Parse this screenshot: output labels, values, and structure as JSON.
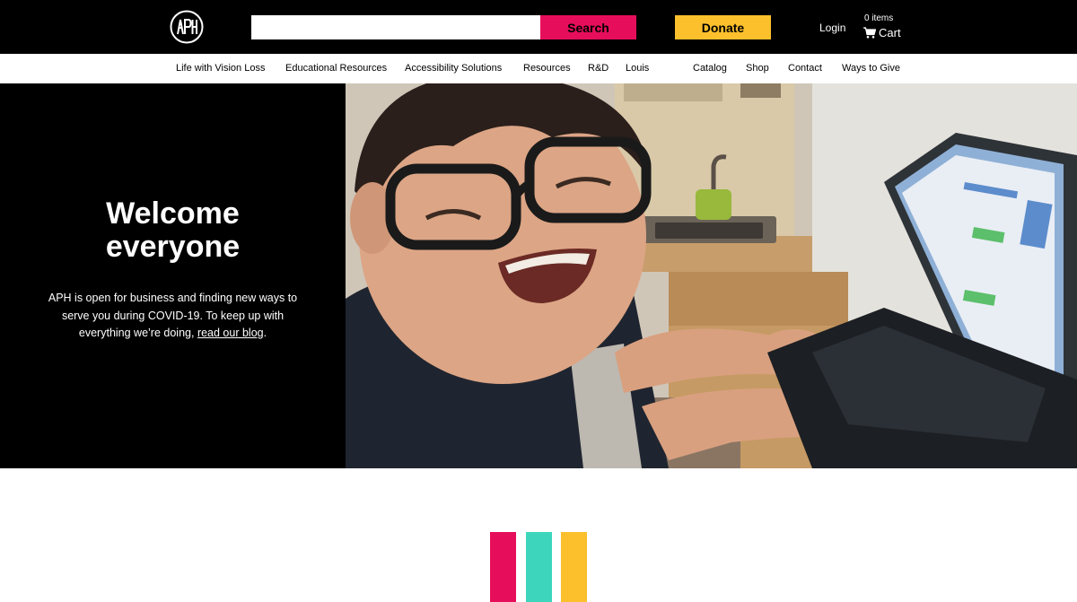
{
  "brand": {
    "logo_text": "APH",
    "colors": {
      "pink": "#e60e5a",
      "teal": "#3dd6bd",
      "yellow": "#fcc02d",
      "black": "#000000"
    }
  },
  "header": {
    "search": {
      "value": "",
      "placeholder": "",
      "button_label": "Search"
    },
    "donate_label": "Donate",
    "login_label": "Login",
    "cart": {
      "count_label": "0 items",
      "label": "Cart",
      "icon": "cart-icon"
    }
  },
  "nav": {
    "items": [
      {
        "label": "Life with Vision Loss"
      },
      {
        "label": "Educational Resources"
      },
      {
        "label": "Accessibility Solutions"
      },
      {
        "label": "Resources"
      },
      {
        "label": "R&D"
      },
      {
        "label": "Louis"
      },
      {
        "label": "Catalog"
      },
      {
        "label": "Shop"
      },
      {
        "label": "Contact"
      },
      {
        "label": "Ways to Give"
      }
    ]
  },
  "hero": {
    "title_line1": "Welcome",
    "title_line2": "everyone",
    "text_before_link": "APH is open for business and finding new ways to serve you during COVID-19. To keep up with everything we’re doing, ",
    "link_label": "read our blog",
    "text_after_link": "."
  }
}
